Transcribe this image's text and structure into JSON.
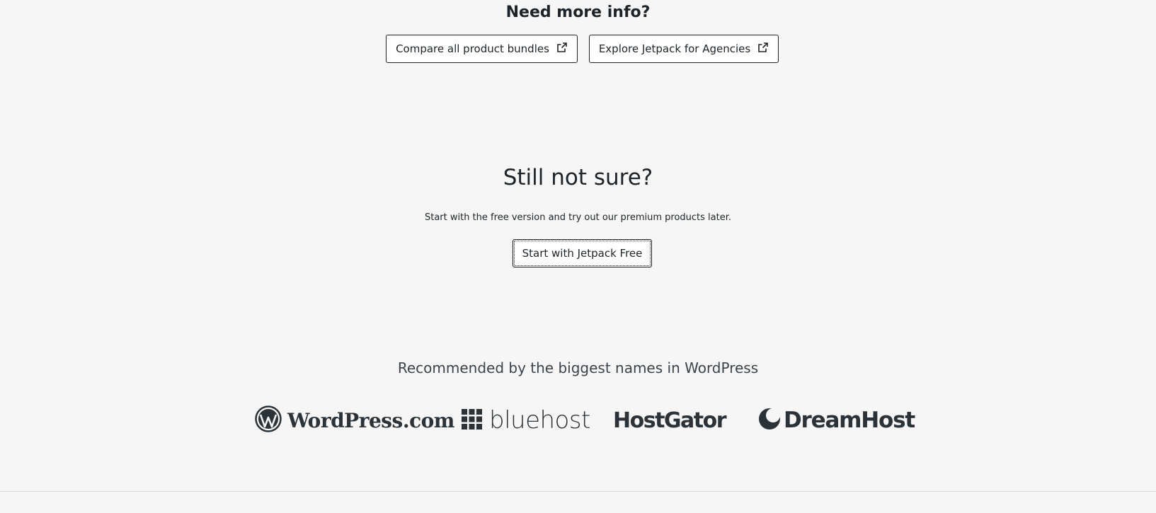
{
  "more_info": {
    "title": "Need more info?",
    "compare_label": "Compare all product bundles",
    "agencies_label": "Explore Jetpack for Agencies"
  },
  "still_not_sure": {
    "title": "Still not sure?",
    "subtitle": "Start with the free version and try out our premium products later.",
    "button_label": "Start with Jetpack Free"
  },
  "recommended": {
    "heading": "Recommended by the biggest names in WordPress",
    "logos": [
      {
        "name": "WordPress.com",
        "icon": "wordpress-logo-icon"
      },
      {
        "name": "bluehost",
        "icon": "bluehost-grid-icon"
      },
      {
        "name": "HostGator",
        "icon": ""
      },
      {
        "name": "DreamHost",
        "icon": "dreamhost-moon-icon"
      }
    ]
  },
  "colors": {
    "background": "#f6f6f6",
    "text": "#1d2327",
    "logo": "#2c3338"
  }
}
